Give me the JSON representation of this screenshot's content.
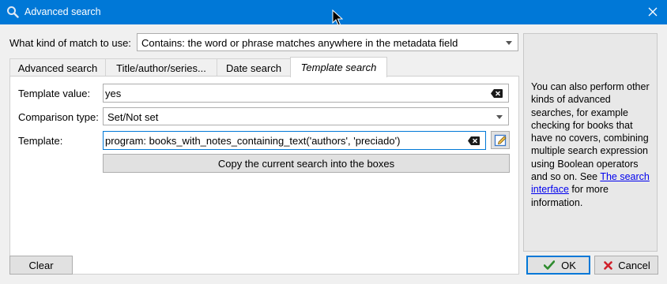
{
  "window": {
    "title": "Advanced search"
  },
  "match_kind": {
    "label": "What kind of match to use:",
    "selected": "Contains: the word or phrase matches anywhere in the metadata field"
  },
  "tabs": [
    {
      "label": "Advanced search",
      "active": false
    },
    {
      "label": "Title/author/series...",
      "active": false
    },
    {
      "label": "Date search",
      "active": false
    },
    {
      "label": "Template search",
      "active": true
    }
  ],
  "template_search": {
    "template_value_label": "Template value:",
    "template_value": "yes",
    "comparison_type_label": "Comparison type:",
    "comparison_type": "Set/Not set",
    "template_label": "Template:",
    "template": "program: books_with_notes_containing_text('authors', 'preciado')",
    "copy_button": "Copy the current search into the boxes"
  },
  "help": {
    "text_before": "You can also perform other kinds of advanced searches, for example checking for books that have no covers, combining multiple search expression using Boolean operators and so on. See ",
    "link": "The search interface",
    "text_after": " for more information."
  },
  "buttons": {
    "clear": "Clear",
    "ok": "OK",
    "cancel": "Cancel"
  },
  "colors": {
    "titlebar": "#0078d7",
    "ok_check": "#2e8b2e",
    "cancel_x": "#d0202a",
    "link": "#0000ee"
  }
}
